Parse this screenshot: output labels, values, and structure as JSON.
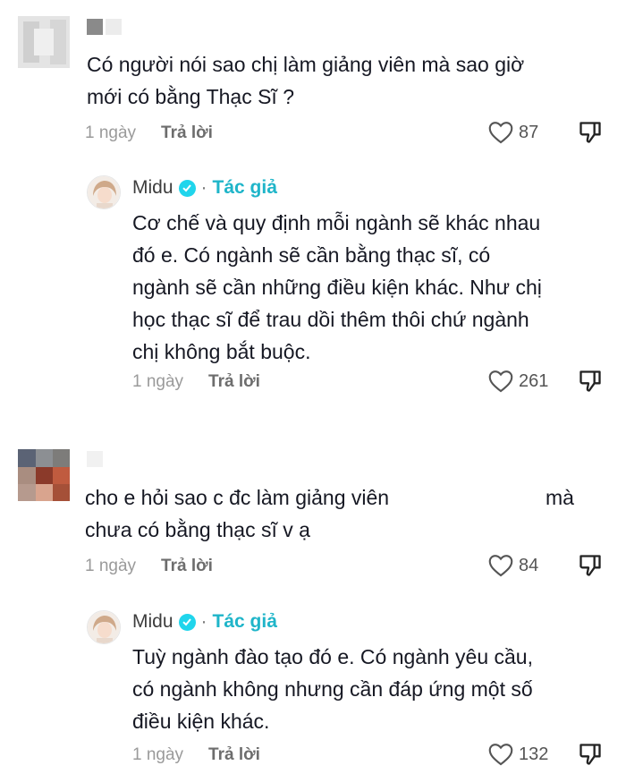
{
  "comments": [
    {
      "text": "Có người nói sao chị làm giảng viên mà sao giờ\nmới có bằng Thạc Sĩ ?",
      "time": "1 ngày",
      "reply_label": "Trả lời",
      "likes": "87",
      "reply": {
        "author": "Midu",
        "tag": "Tác giả",
        "dot": "·",
        "text": "Cơ chế và quy định mỗi ngành sẽ khác nhau\nđó e. Có ngành sẽ cần bằng thạc sĩ, có\nngành sẽ cần những điều kiện khác. Như chị\nhọc thạc sĩ để trau dồi thêm thôi chứ ngành\nchị không bắt buộc.",
        "time": "1 ngày",
        "reply_label": "Trả lời",
        "likes": "261"
      }
    },
    {
      "text_part1": "cho e hỏi sao c đc làm giảng viên",
      "text_part2": "mà",
      "text_line2": "chưa có bằng thạc sĩ v ạ",
      "time": "1 ngày",
      "reply_label": "Trả lời",
      "likes": "84",
      "reply": {
        "author": "Midu",
        "tag": "Tác giả",
        "dot": "·",
        "text": "Tuỳ ngành đào tạo đó e. Có ngành yêu cầu,\ncó ngành không nhưng cần đáp ứng một số\nđiều kiện khác.",
        "time": "1 ngày",
        "reply_label": "Trả lời",
        "likes": "132"
      }
    }
  ],
  "colors": {
    "verified": "#20d5ec",
    "author_tag": "#1fb5c9",
    "meta": "#9a9a9a"
  },
  "icons": [
    "heart-icon",
    "dislike-icon",
    "verified-check-icon"
  ]
}
